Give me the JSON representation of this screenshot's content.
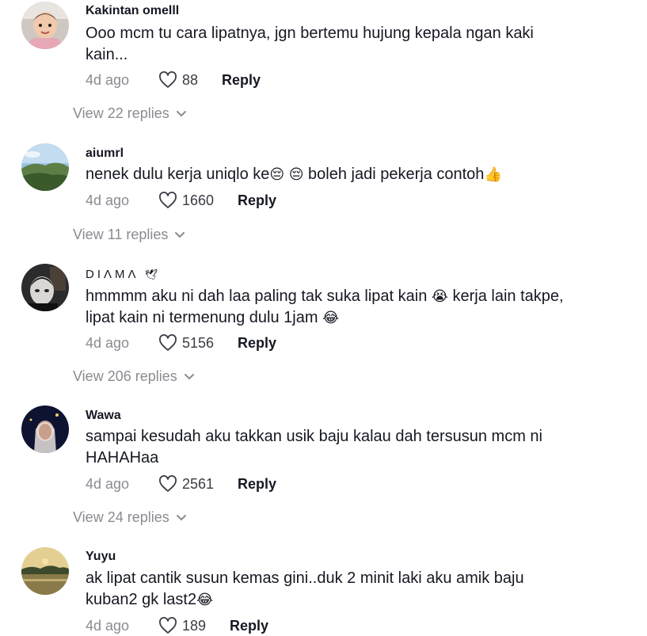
{
  "comments": [
    {
      "username": "Kakintan omelll",
      "text": "Ooo mcm tu cara lipatnya, jgn bertemu hujung kepala ngan kaki kain...",
      "time": "4d ago",
      "likes": "88",
      "reply_label": "Reply",
      "view_replies": "View 22 replies",
      "avatar_icon": "baby-photo"
    },
    {
      "username": "aiumrl",
      "text_parts": [
        "nenek dulu kerja uniqlo ke",
        "😔",
        " ",
        "😔",
        "  boleh jadi pekerja contoh",
        "👍"
      ],
      "time": "4d ago",
      "likes": "1660",
      "reply_label": "Reply",
      "view_replies": "View 11 replies",
      "avatar_icon": "landscape-photo"
    },
    {
      "username": "DIΛMΛ",
      "username_glyph": "🕊",
      "text_parts": [
        "hmmmm aku ni dah laa paling tak suka lipat kain ",
        "😭",
        "  kerja lain takpe, lipat kain ni termenung dulu 1jam ",
        "😂"
      ],
      "time": "4d ago",
      "likes": "5156",
      "reply_label": "Reply",
      "view_replies": "View 206 replies",
      "avatar_icon": "masked-person-photo"
    },
    {
      "username": "Wawa",
      "text": "sampai kesudah aku takkan usik baju kalau dah tersusun mcm ni HAHAHaa",
      "time": "4d ago",
      "likes": "2561",
      "reply_label": "Reply",
      "view_replies": "View 24 replies",
      "avatar_icon": "night-portrait-photo"
    },
    {
      "username": "Yuyu",
      "text_parts": [
        "ak lipat cantik susun kemas gini..duk 2 minit laki aku amik baju kuban2 gk last2",
        "😂"
      ],
      "time": "4d ago",
      "likes": "189",
      "reply_label": "Reply",
      "avatar_icon": "sunset-lake-photo"
    }
  ],
  "colors": {
    "primary_text": "#161823",
    "secondary_text": "#8a8b91",
    "count_text": "#3b3c44"
  }
}
